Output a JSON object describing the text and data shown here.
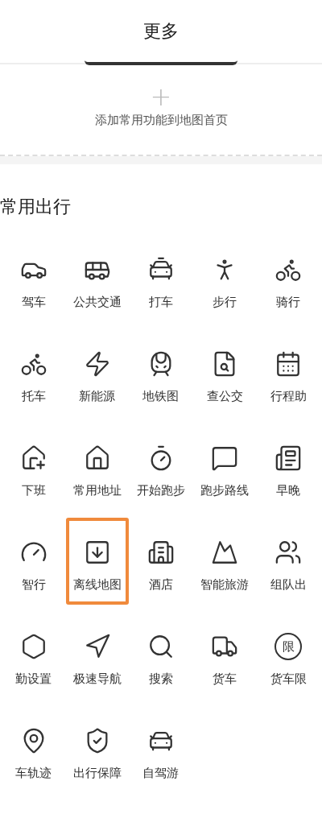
{
  "tabs": [
    {
      "label": "更多",
      "selected": true
    }
  ],
  "add_card": {
    "icon": "+",
    "label": "添加常用功能到地图首页"
  },
  "section": {
    "title": "常用出行",
    "items": [
      {
        "label": "驾车",
        "highlighted": false
      },
      {
        "label": "公共交通",
        "highlighted": false
      },
      {
        "label": "打车",
        "highlighted": false
      },
      {
        "label": "步行",
        "highlighted": false
      },
      {
        "label": "骑行",
        "highlighted": false
      },
      {
        "label": "托车",
        "highlighted": false
      },
      {
        "label": "新能源",
        "highlighted": false
      },
      {
        "label": "地铁图",
        "highlighted": false
      },
      {
        "label": "查公交",
        "highlighted": false
      },
      {
        "label": "行程助",
        "highlighted": false
      },
      {
        "label": "下班",
        "highlighted": false
      },
      {
        "label": "常用地址",
        "highlighted": false
      },
      {
        "label": "开始跑步",
        "highlighted": false
      },
      {
        "label": "跑步路线",
        "highlighted": false
      },
      {
        "label": "早晚",
        "highlighted": false
      },
      {
        "label": "智行",
        "highlighted": false
      },
      {
        "label": "离线地图",
        "highlighted": true
      },
      {
        "label": "酒店",
        "highlighted": false
      },
      {
        "label": "智能旅游",
        "highlighted": false
      },
      {
        "label": "组队出",
        "highlighted": false
      },
      {
        "label": "勤设置",
        "highlighted": false
      },
      {
        "label": "极速导航",
        "highlighted": false
      },
      {
        "label": "搜索",
        "highlighted": false
      },
      {
        "label": "货车",
        "highlighted": false
      },
      {
        "label": "货车限",
        "highlighted": false,
        "icon_text": "限"
      },
      {
        "label": "车轨迹",
        "highlighted": false
      },
      {
        "label": "出行保障",
        "highlighted": false
      },
      {
        "label": "自驾游",
        "highlighted": false
      }
    ]
  }
}
